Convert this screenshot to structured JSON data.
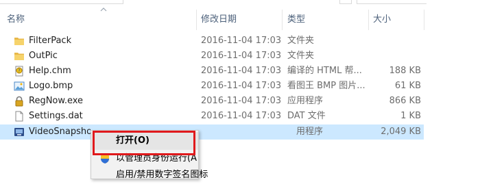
{
  "columns": {
    "name": "名称",
    "date": "修改日期",
    "type": "类型",
    "size": "大小"
  },
  "files": [
    {
      "icon": "folder-icon",
      "name": "FilterPack",
      "date": "2016-11-04 17:03",
      "type": "文件夹",
      "size": ""
    },
    {
      "icon": "folder-icon",
      "name": "OutPic",
      "date": "2016-11-04 17:03",
      "type": "文件夹",
      "size": ""
    },
    {
      "icon": "help-file-icon",
      "name": "Help.chm",
      "date": "2016-11-04 17:03",
      "type": "编译的 HTML 帮...",
      "size": "188 KB"
    },
    {
      "icon": "image-file-icon",
      "name": "Logo.bmp",
      "date": "2016-11-04 17:03",
      "type": "看图王 BMP 图片...",
      "size": "61 KB"
    },
    {
      "icon": "lock-app-icon",
      "name": "RegNow.exe",
      "date": "2016-11-04 17:03",
      "type": "应用程序",
      "size": "866 KB"
    },
    {
      "icon": "blank-file-icon",
      "name": "Settings.dat",
      "date": "2016-11-04 17:03",
      "type": "DAT 文件",
      "size": "1 KB"
    },
    {
      "icon": "app-icon",
      "name": "VideoSnapsho",
      "date": "",
      "type": "用程序",
      "size": "2,049 KB",
      "selected": true
    }
  ],
  "context_menu": {
    "items": [
      {
        "label": "打开(O)",
        "default": true
      },
      {
        "label": "以管理员身份运行(A",
        "icon": "uac-shield-icon"
      },
      {
        "label": "启用/禁用数字签名图标"
      }
    ]
  },
  "colors": {
    "selection": "#cce8ff",
    "highlight_box": "#e0191c",
    "header_text": "#4c607a"
  }
}
